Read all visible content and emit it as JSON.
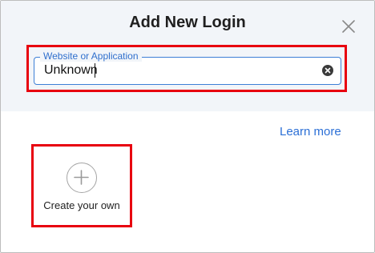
{
  "dialog": {
    "title": "Add New Login",
    "close_icon": "close-icon"
  },
  "search": {
    "label": "Website or Application",
    "value": "Unknown",
    "clear_icon": "clear-circle-icon"
  },
  "links": {
    "learn_more": "Learn more"
  },
  "create": {
    "label": "Create your own",
    "icon": "plus-circle-icon"
  },
  "colors": {
    "highlight": "#e8000f",
    "accent": "#2b6fd6",
    "header_bg": "#f2f5f9"
  }
}
